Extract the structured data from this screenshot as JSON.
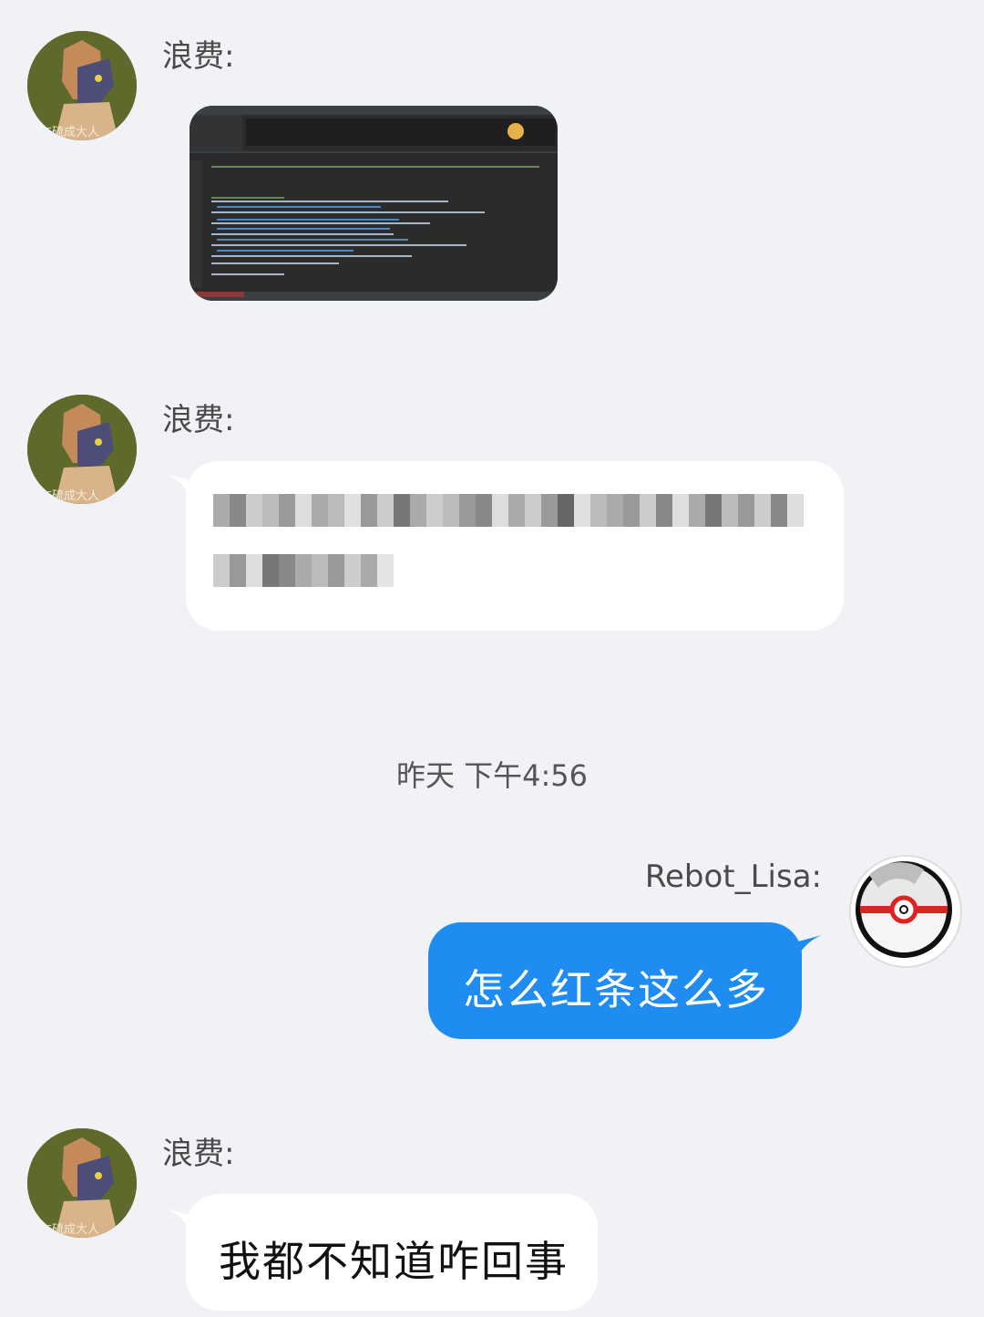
{
  "messages": [
    {
      "sender": "浪费:",
      "type": "image",
      "image_alt": "IDE screenshot with console output"
    },
    {
      "sender": "浪费:",
      "type": "text",
      "text_redacted": true
    },
    {
      "timestamp": "昨天 下午4:56"
    },
    {
      "sender": "Rebot_Lisa:",
      "type": "text",
      "text": "怎么红条这么多"
    },
    {
      "sender": "浪费:",
      "type": "text",
      "text": "我都不知道咋回事"
    }
  ],
  "avatar_caption": "友硫成大人",
  "colors": {
    "background": "#f1f2f5",
    "incoming_bubble": "#ffffff",
    "outgoing_bubble": "#1e8cf0"
  },
  "icons": {
    "left_avatar": "wolf-avatar-icon",
    "right_avatar": "pokeball-avatar-icon"
  }
}
